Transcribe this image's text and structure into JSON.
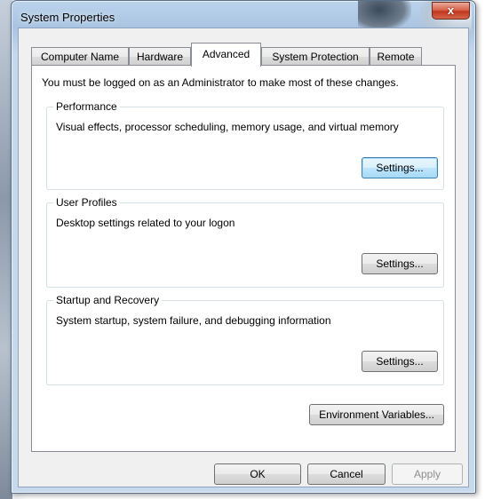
{
  "window": {
    "title": "System Properties",
    "close_label": "x"
  },
  "tabs": [
    {
      "label": "Computer Name",
      "active": false
    },
    {
      "label": "Hardware",
      "active": false
    },
    {
      "label": "Advanced",
      "active": true
    },
    {
      "label": "System Protection",
      "active": false
    },
    {
      "label": "Remote",
      "active": false
    }
  ],
  "advanced": {
    "intro": "You must be logged on as an Administrator to make most of these changes.",
    "performance": {
      "title": "Performance",
      "description": "Visual effects, processor scheduling, memory usage, and virtual memory",
      "settings_label": "Settings..."
    },
    "user_profiles": {
      "title": "User Profiles",
      "description": "Desktop settings related to your logon",
      "settings_label": "Settings..."
    },
    "startup_recovery": {
      "title": "Startup and Recovery",
      "description": "System startup, system failure, and debugging information",
      "settings_label": "Settings..."
    },
    "env_vars_label": "Environment Variables..."
  },
  "footer": {
    "ok_label": "OK",
    "cancel_label": "Cancel",
    "apply_label": "Apply"
  }
}
